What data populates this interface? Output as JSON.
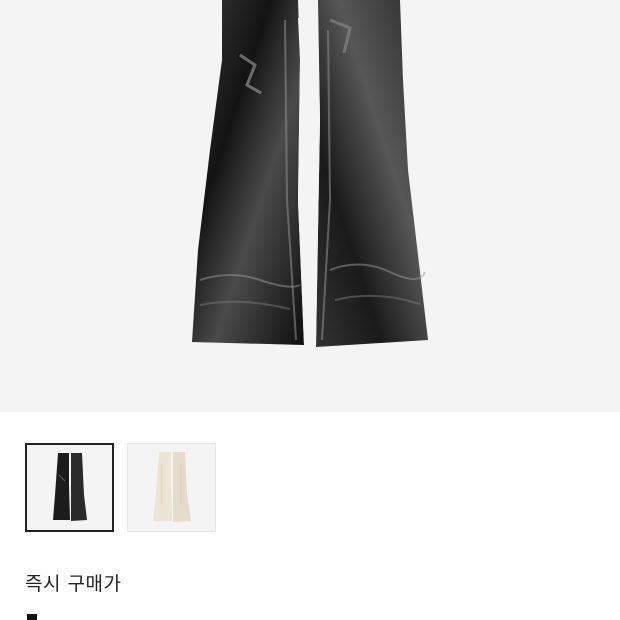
{
  "product": {
    "main_image_icon": "flared-jeans-black-image",
    "thumbnails": [
      {
        "icon": "flared-jeans-black-thumb",
        "color": "#1c1c1c",
        "selected": true
      },
      {
        "icon": "flared-jeans-cream-thumb",
        "color": "#ece4d4",
        "selected": false
      }
    ],
    "price_label": "즉시 구매가"
  }
}
